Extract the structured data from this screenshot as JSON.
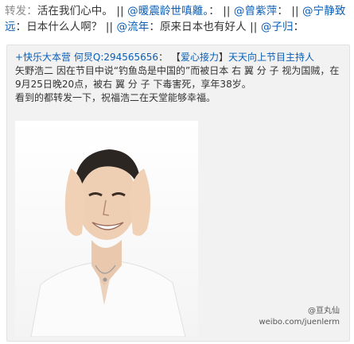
{
  "repost": {
    "prefix": "转发：",
    "chain": [
      {
        "user": "",
        "text": "活在我们心中。"
      },
      {
        "user": "@暖震龄世嗔離。",
        "text": "："
      },
      {
        "user": "@曾紫萍",
        "text": "："
      },
      {
        "user": "@宁静致远",
        "text": "：日本什么人啊？"
      },
      {
        "user": "@流年",
        "text": "：原来日本也有好人"
      },
      {
        "user": "@子归",
        "text": "："
      }
    ],
    "separator": "||"
  },
  "quote": {
    "author": "+快乐大本营 何炅Q:294565656",
    "colon": "：",
    "tag_open": "【",
    "tag": "爱心接力",
    "tag_close": "】",
    "lead": "天天向上节目主持人",
    "body_1": "矢野浩二 因在节目中说“钓鱼岛是中国的”而被日本 右 翼 分 子 视为国贼，在",
    "body_2": "9月25日晚20点，被右 翼 分 子 下毒害死，享年38岁。",
    "body_3": "看到的都转发一下，祝福浩二在天堂能够幸福。"
  },
  "image": {
    "watermark_user": "@亘丸仙",
    "watermark_site": "weibo.com/juenlerm"
  }
}
